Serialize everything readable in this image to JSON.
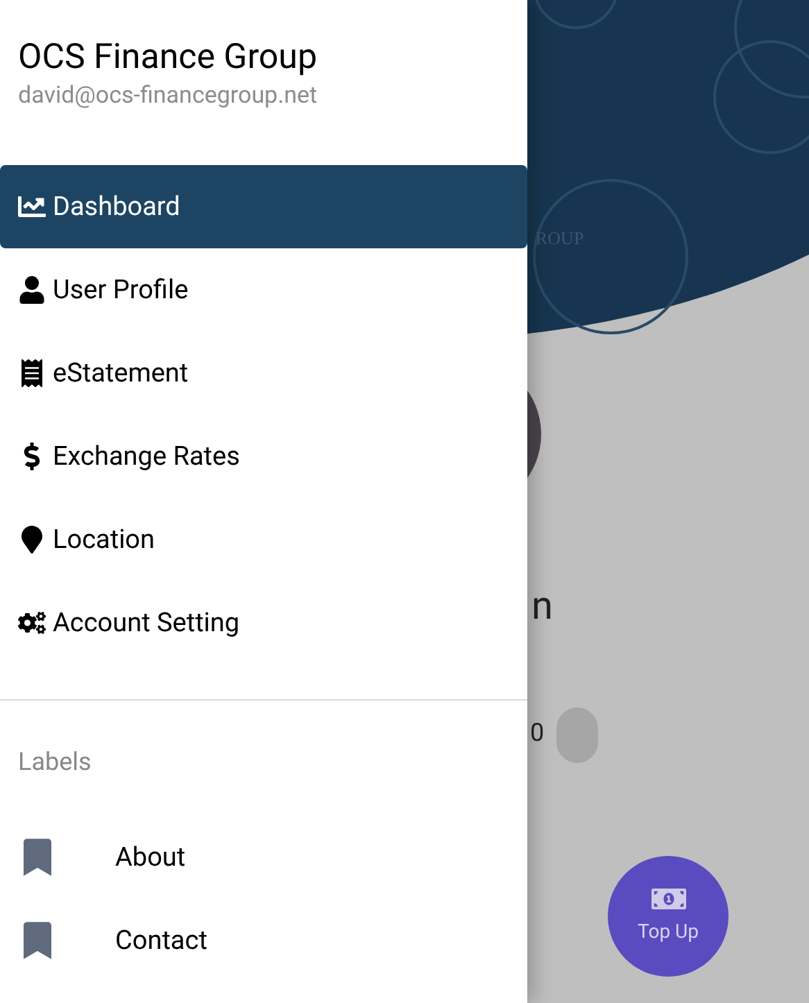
{
  "drawer": {
    "title": "OCS Finance Group",
    "email": "david@ocs-financegroup.net",
    "menu": [
      {
        "label": "Dashboard",
        "kind": "chart",
        "selected": true
      },
      {
        "label": "User Profile",
        "kind": "user",
        "selected": false
      },
      {
        "label": "eStatement",
        "kind": "receipt",
        "selected": false
      },
      {
        "label": "Exchange Rates",
        "kind": "dollar",
        "selected": false
      },
      {
        "label": "Location",
        "kind": "pin",
        "selected": false
      },
      {
        "label": "Account Setting",
        "kind": "gears",
        "selected": false
      }
    ],
    "labels_heading": "Labels",
    "labels": [
      {
        "label": "About"
      },
      {
        "label": "Contact"
      }
    ]
  },
  "background": {
    "logo_text": "ROUP",
    "name_text": "n",
    "balance_text": "0",
    "top_up": {
      "label": "Top Up"
    }
  }
}
